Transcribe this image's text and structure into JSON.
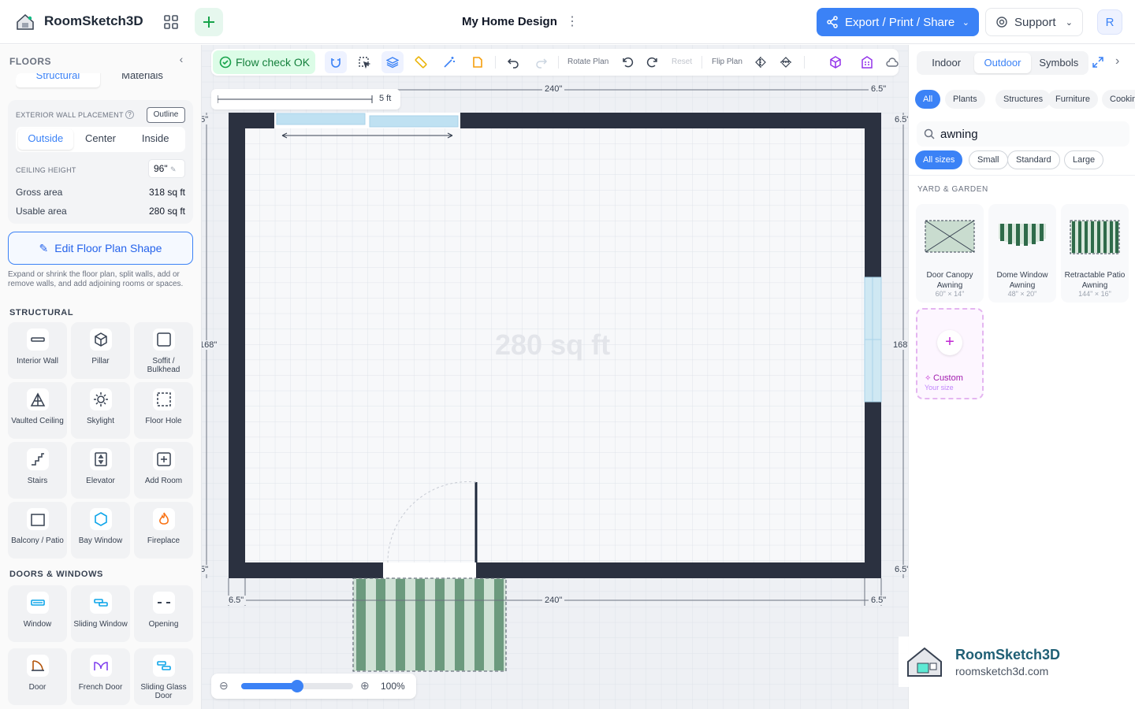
{
  "header": {
    "app_name": "RoomSketch3D",
    "doc_title": "My Home Design",
    "export_label": "Export / Print / Share",
    "support_label": "Support",
    "avatar_initial": "R"
  },
  "sidebar": {
    "title": "FLOORS",
    "tabs": [
      "Structural",
      "Materials"
    ],
    "wall_placement_label": "EXTERIOR WALL PLACEMENT",
    "outline_label": "Outline",
    "placement_options": [
      "Outside",
      "Center",
      "Inside"
    ],
    "ceiling_label": "CEILING HEIGHT",
    "ceiling_value": "96\"",
    "gross_label": "Gross area",
    "gross_value": "318 sq ft",
    "usable_label": "Usable area",
    "usable_value": "280 sq ft",
    "edit_shape_label": "Edit Floor Plan Shape",
    "help_text": "Expand or shrink the floor plan, split walls, add or remove walls, and add adjoining rooms or spaces.",
    "structural_title": "STRUCTURAL",
    "structural_tools": [
      {
        "label": "Interior Wall",
        "icon": "interior-wall-icon"
      },
      {
        "label": "Pillar",
        "icon": "pillar-icon"
      },
      {
        "label": "Soffit / Bulkhead",
        "icon": "soffit-icon"
      },
      {
        "label": "Vaulted Ceiling",
        "icon": "vaulted-ceiling-icon"
      },
      {
        "label": "Skylight",
        "icon": "skylight-icon"
      },
      {
        "label": "Floor Hole",
        "icon": "floor-hole-icon"
      },
      {
        "label": "Stairs",
        "icon": "stairs-icon"
      },
      {
        "label": "Elevator",
        "icon": "elevator-icon"
      },
      {
        "label": "Add Room",
        "icon": "add-room-icon"
      },
      {
        "label": "Balcony / Patio",
        "icon": "balcony-icon"
      },
      {
        "label": "Bay Window",
        "icon": "bay-window-icon"
      },
      {
        "label": "Fireplace",
        "icon": "fireplace-icon"
      }
    ],
    "doors_title": "DOORS & WINDOWS",
    "door_tools": [
      {
        "label": "Window",
        "icon": "window-icon"
      },
      {
        "label": "Sliding Window",
        "icon": "sliding-window-icon"
      },
      {
        "label": "Opening",
        "icon": "opening-icon"
      },
      {
        "label": "Door",
        "icon": "door-icon"
      },
      {
        "label": "French Door",
        "icon": "french-door-icon"
      },
      {
        "label": "Sliding Glass Door",
        "icon": "sliding-glass-door-icon"
      }
    ]
  },
  "toolbar": {
    "flow_check": "Flow check OK",
    "rotate_label": "Rotate Plan",
    "reset_label": "Reset",
    "flip_label": "Flip Plan"
  },
  "canvas": {
    "scale_label": "5 ft",
    "area_label": "280 sq ft",
    "dims": {
      "top_width": "240\"",
      "bottom_width": "240\"",
      "left_height": "168\"",
      "right_height": "168\"",
      "wall": "6.5\""
    },
    "zoom_value": "100%",
    "zoom_fraction": 0.5
  },
  "right": {
    "tabs": [
      "Indoor",
      "Outdoor",
      "Symbols"
    ],
    "filters": [
      "All",
      "Plants",
      "Structures",
      "Furniture",
      "Cookin"
    ],
    "search_value": "awning",
    "sizes": [
      "All sizes",
      "Small",
      "Standard",
      "Large"
    ],
    "section_title": "YARD & GARDEN",
    "items": [
      {
        "name": "Door Canopy Awning",
        "size": "60\" × 14\""
      },
      {
        "name": "Dome Window Awning",
        "size": "48\" × 20\""
      },
      {
        "name": "Retractable Patio Awning",
        "size": "144\" × 16\""
      }
    ],
    "custom_title": "Custom",
    "custom_sub": "Your size"
  },
  "watermark": {
    "name": "RoomSketch3D",
    "url": "roomsketch3d.com"
  }
}
